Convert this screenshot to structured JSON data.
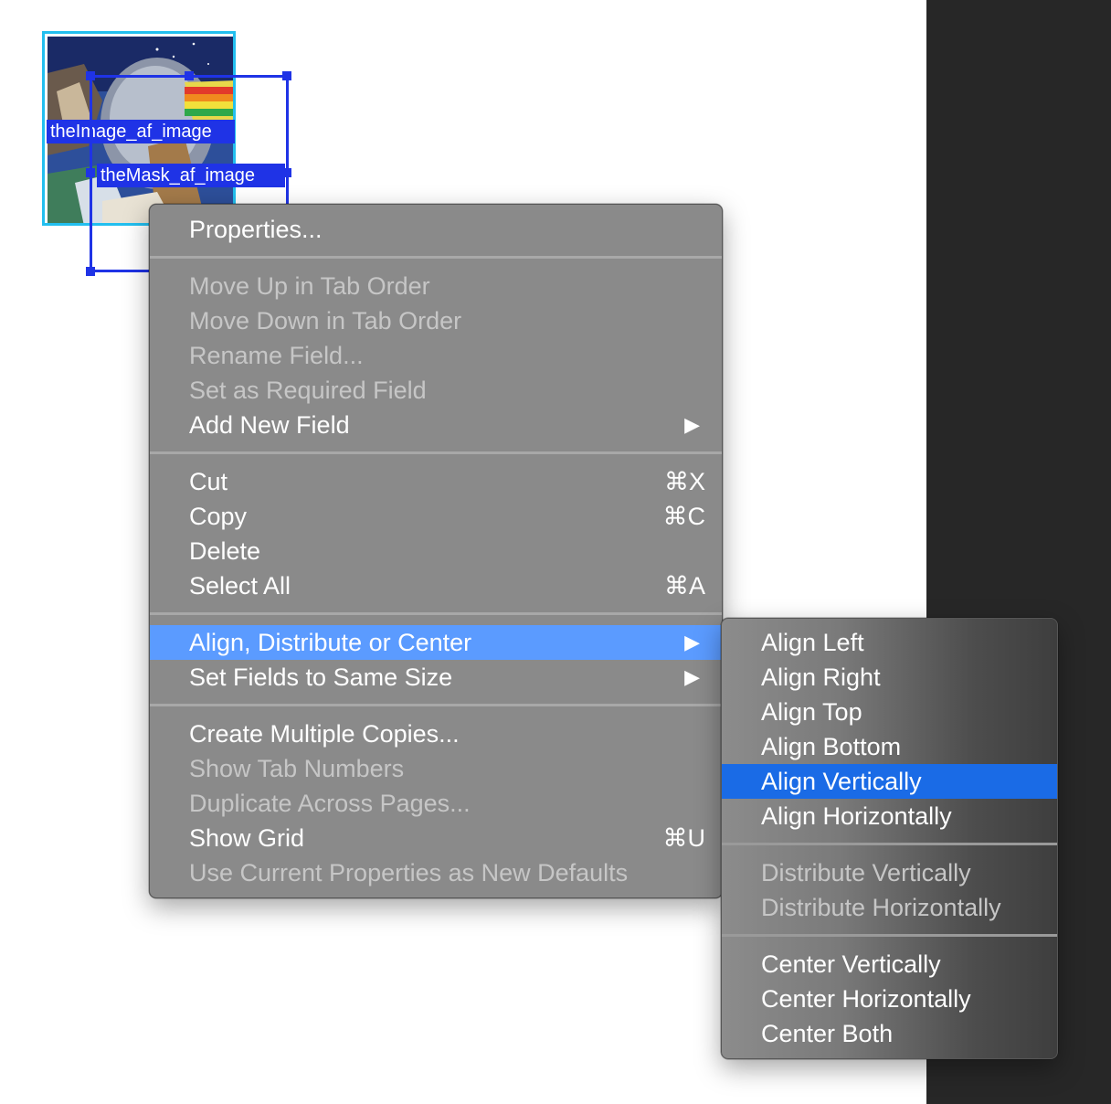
{
  "canvas": {
    "image_field_label": "theImage_af_image",
    "mask_field_label": "theMask_af_image"
  },
  "main_menu": {
    "properties": "Properties...",
    "move_up": "Move Up in Tab Order",
    "move_down": "Move Down in Tab Order",
    "rename": "Rename Field...",
    "set_required": "Set as Required Field",
    "add_new_field": "Add New Field",
    "cut": "Cut",
    "cut_shortcut": "⌘X",
    "copy": "Copy",
    "copy_shortcut": "⌘C",
    "delete": "Delete",
    "select_all": "Select All",
    "select_all_shortcut": "⌘A",
    "align_distribute": "Align, Distribute or Center",
    "same_size": "Set Fields to Same Size",
    "multiple_copies": "Create Multiple Copies...",
    "tab_numbers": "Show Tab Numbers",
    "duplicate_pages": "Duplicate Across Pages...",
    "show_grid": "Show Grid",
    "show_grid_shortcut": "⌘U",
    "current_props": "Use Current Properties as New Defaults",
    "submenu_arrow": "▶"
  },
  "sub_menu": {
    "align_left": "Align Left",
    "align_right": "Align Right",
    "align_top": "Align Top",
    "align_bottom": "Align Bottom",
    "align_vertically": "Align Vertically",
    "align_horizontally": "Align Horizontally",
    "distribute_vertically": "Distribute Vertically",
    "distribute_horizontally": "Distribute Horizontally",
    "center_vertically": "Center Vertically",
    "center_horizontally": "Center Horizontally",
    "center_both": "Center Both"
  },
  "colors": {
    "highlight_main": "#5b9bff",
    "highlight_sub": "#1a6be6",
    "field_border_selected": "#1f33e6",
    "field_border": "#22bfef"
  }
}
